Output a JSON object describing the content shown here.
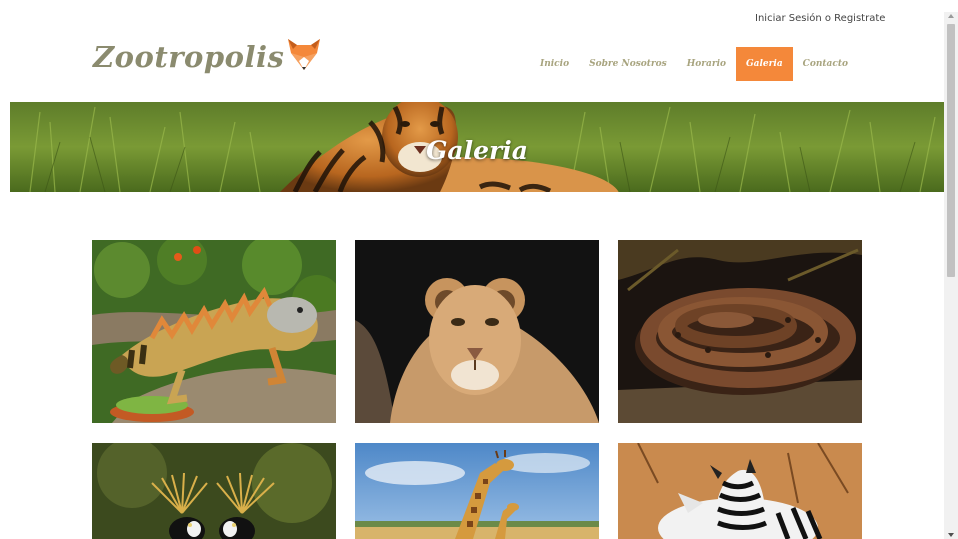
{
  "header": {
    "login_text": "Iniciar Sesión o Registrate",
    "logo_text": "Zootropolis",
    "logo_icon": "fox-icon"
  },
  "nav": {
    "items": [
      {
        "label": "Inicio",
        "active": false
      },
      {
        "label": "Sobre Nosotros",
        "active": false
      },
      {
        "label": "Horario",
        "active": false
      },
      {
        "label": "Galeria",
        "active": true
      },
      {
        "label": "Contacto",
        "active": false
      }
    ]
  },
  "banner": {
    "title": "Galeria",
    "image": "tiger-in-grass"
  },
  "gallery": {
    "images": [
      "iguana",
      "lioness",
      "anaconda",
      "crowned-crane",
      "giraffe",
      "zebra"
    ]
  },
  "colors": {
    "accent": "#f4883a",
    "logo": "#8b8b6f",
    "nav_text": "#a8a47f"
  }
}
